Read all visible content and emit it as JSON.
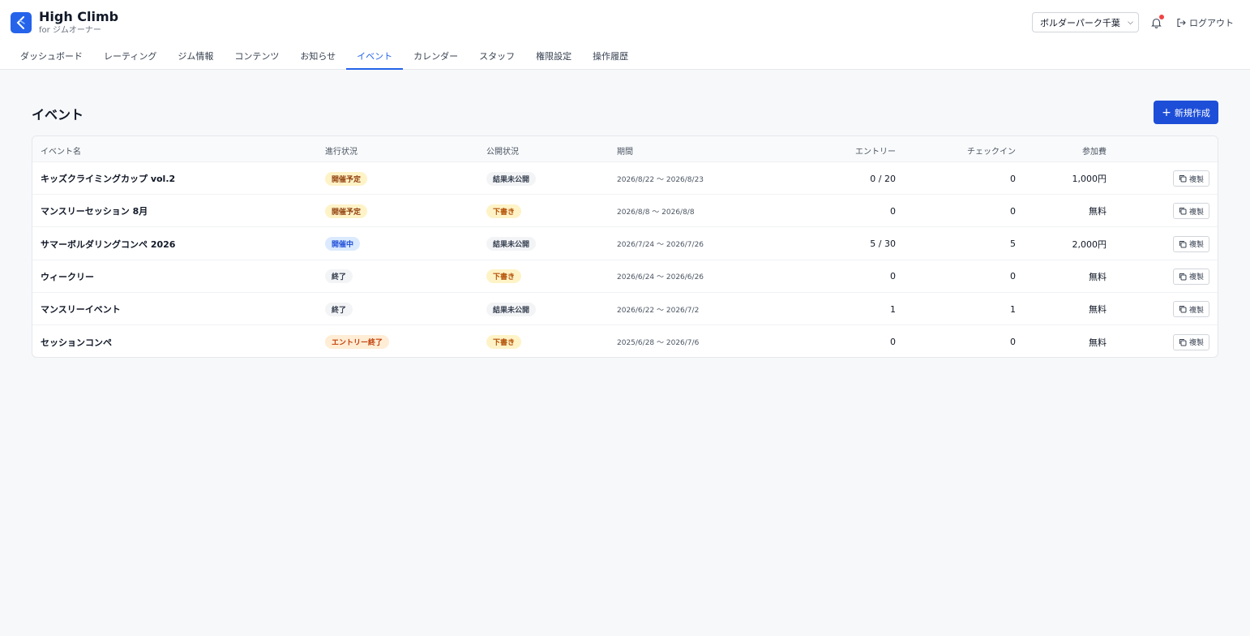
{
  "app": {
    "title": "High Climb",
    "subtitle": "for ジムオーナー"
  },
  "header": {
    "gym_select": "ボルダーパーク千葉",
    "logout_label": "ログアウト",
    "notification_dot": true
  },
  "nav": {
    "items": [
      "ダッシュボード",
      "レーティング",
      "ジム情報",
      "コンテンツ",
      "お知らせ",
      "イベント",
      "カレンダー",
      "スタッフ",
      "権限設定",
      "操作履歴"
    ],
    "active": "イベント"
  },
  "page": {
    "title": "イベント",
    "new_button_label": "新規作成"
  },
  "table": {
    "headers": {
      "name": "イベント名",
      "progress": "進行状況",
      "publish": "公開状況",
      "period": "期間",
      "entries": "エントリー",
      "checkins": "チェックイン",
      "fee": "参加費"
    },
    "copy_label": "複製",
    "rows": [
      {
        "name": "キッズクライミングカップ vol.2",
        "progress": "開催予定",
        "progress_tone": "yellow",
        "publish": "結果未公開",
        "publish_tone": "gray",
        "period": "2026/8/22 〜 2026/8/23",
        "entries": "0 / 20",
        "checkins": "0",
        "fee": "1,000円"
      },
      {
        "name": "マンスリーセッション 8月",
        "progress": "開催予定",
        "progress_tone": "yellow",
        "publish": "下書き",
        "publish_tone": "amber",
        "period": "2026/8/8 〜 2026/8/8",
        "entries": "0",
        "checkins": "0",
        "fee": "無料"
      },
      {
        "name": "サマーボルダリングコンペ 2026",
        "progress": "開催中",
        "progress_tone": "blue",
        "publish": "結果未公開",
        "publish_tone": "gray",
        "period": "2026/7/24 〜 2026/7/26",
        "entries": "5 / 30",
        "checkins": "5",
        "fee": "2,000円"
      },
      {
        "name": "ウィークリー",
        "progress": "終了",
        "progress_tone": "gray",
        "publish": "下書き",
        "publish_tone": "amber",
        "period": "2026/6/24 〜 2026/6/26",
        "entries": "0",
        "checkins": "0",
        "fee": "無料"
      },
      {
        "name": "マンスリーイベント",
        "progress": "終了",
        "progress_tone": "gray",
        "publish": "結果未公開",
        "publish_tone": "gray",
        "period": "2026/6/22 〜 2026/7/2",
        "entries": "1",
        "checkins": "1",
        "fee": "無料"
      },
      {
        "name": "セッションコンペ",
        "progress": "エントリー終了",
        "progress_tone": "orange",
        "publish": "下書き",
        "publish_tone": "amber",
        "period": "2025/6/28 〜 2026/7/6",
        "entries": "0",
        "checkins": "0",
        "fee": "無料"
      }
    ]
  },
  "colors": {
    "accent": "#2563eb",
    "primary_button": "#1d4ed8",
    "notification": "#ef4444"
  }
}
